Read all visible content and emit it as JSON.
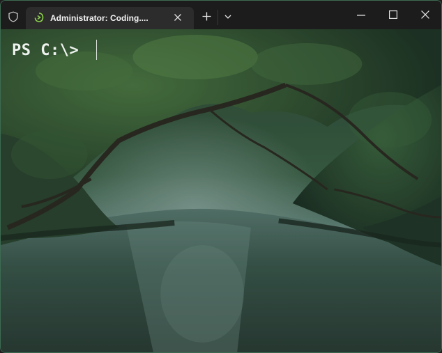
{
  "titlebar": {
    "shield_icon": "shield-icon",
    "tab": {
      "title": "Administrator: Coding....",
      "icon": "terminal-profile-icon",
      "close_icon": "close-icon"
    },
    "new_tab_icon": "plus-icon",
    "dropdown_icon": "chevron-down-icon",
    "window_controls": [
      "minimize-icon",
      "maximize-icon",
      "close-icon"
    ]
  },
  "terminal": {
    "prompt": "PS C:\\> ",
    "background": "river-through-mangrove-forest"
  },
  "colors": {
    "titlebar": "#1c1c1c",
    "tab": "#2c2c2c",
    "accent": "#8bd34a"
  }
}
